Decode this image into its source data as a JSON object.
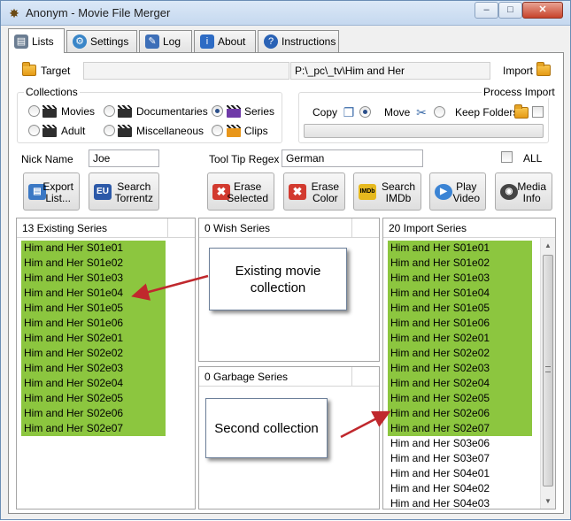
{
  "window": {
    "title": "Anonym - Movie File Merger",
    "min_glyph": "–",
    "max_glyph": "□",
    "close_glyph": "✕"
  },
  "tabs": [
    {
      "label": "Lists",
      "icon": "lists-icon",
      "active": true
    },
    {
      "label": "Settings",
      "icon": "gear-icon",
      "active": false
    },
    {
      "label": "Log",
      "icon": "log-icon",
      "active": false
    },
    {
      "label": "About",
      "icon": "info-icon",
      "active": false
    },
    {
      "label": "Instructions",
      "icon": "help-icon",
      "active": false
    }
  ],
  "target": {
    "label": "Target",
    "path": "",
    "import_path": "P:\\_pc\\_tv\\Him and Her",
    "import_label": "Import"
  },
  "collections": {
    "title": "Collections",
    "options": [
      {
        "label": "Movies",
        "checked": false
      },
      {
        "label": "Documentaries",
        "checked": false
      },
      {
        "label": "Series",
        "checked": true
      },
      {
        "label": "Adult",
        "checked": false
      },
      {
        "label": "Miscellaneous",
        "checked": false
      },
      {
        "label": "Clips",
        "checked": false
      }
    ]
  },
  "process_import": {
    "title": "Process Import",
    "copy_label": "Copy",
    "move_label": "Move",
    "keep_folders_label": "Keep Folders",
    "progress": 0
  },
  "nick": {
    "label": "Nick Name",
    "value": "Joe"
  },
  "tooltip_regex": {
    "label": "Tool Tip Regex",
    "value": "German"
  },
  "all_label": "ALL",
  "buttons": {
    "export_line1": "Export",
    "export_line2": "List...",
    "search_torrentz_line1": "Search",
    "search_torrentz_line2": "Torrentz",
    "erase_selected_line1": "Erase",
    "erase_selected_line2": "Selected",
    "erase_color_line1": "Erase",
    "erase_color_line2": "Color",
    "search_imdb_line1": "Search",
    "search_imdb_line2": "IMDb",
    "play_video_line1": "Play",
    "play_video_line2": "Video",
    "media_info_line1": "Media",
    "media_info_line2": "Info"
  },
  "icon_text": {
    "eu": "EU",
    "imdb": "IMDb"
  },
  "existing": {
    "header": "13 Existing Series",
    "items": [
      "Him and Her S01e01",
      "Him and Her S01e02",
      "Him and Her S01e03",
      "Him and Her S01e04",
      "Him and Her S01e05",
      "Him and Her S01e06",
      "Him and Her S02e01",
      "Him and Her S02e02",
      "Him and Her S02e03",
      "Him and Her S02e04",
      "Him and Her S02e05",
      "Him and Her S02e06",
      "Him and Her S02e07"
    ]
  },
  "wish": {
    "header": "0 Wish Series"
  },
  "garbage": {
    "header": "0 Garbage Series"
  },
  "import_list": {
    "header": "20 Import Series",
    "items": [
      "Him and Her S01e01",
      "Him and Her S01e02",
      "Him and Her S01e03",
      "Him and Her S01e04",
      "Him and Her S01e05",
      "Him and Her S01e06",
      "Him and Her S02e01",
      "Him and Her S02e02",
      "Him and Her S02e03",
      "Him and Her S02e04",
      "Him and Her S02e05",
      "Him and Her S02e06",
      "Him and Her S02e07",
      "Him and Her S03e06",
      "Him and Her S03e07",
      "Him and Her S04e01",
      "Him and Her S04e02",
      "Him and Her S04e03"
    ],
    "highlighted_count": 13
  },
  "callouts": {
    "existing": "Existing movie collection",
    "second": "Second collection"
  },
  "colors": {
    "highlight": "#8cc63f",
    "arrow": "#c0282d"
  }
}
